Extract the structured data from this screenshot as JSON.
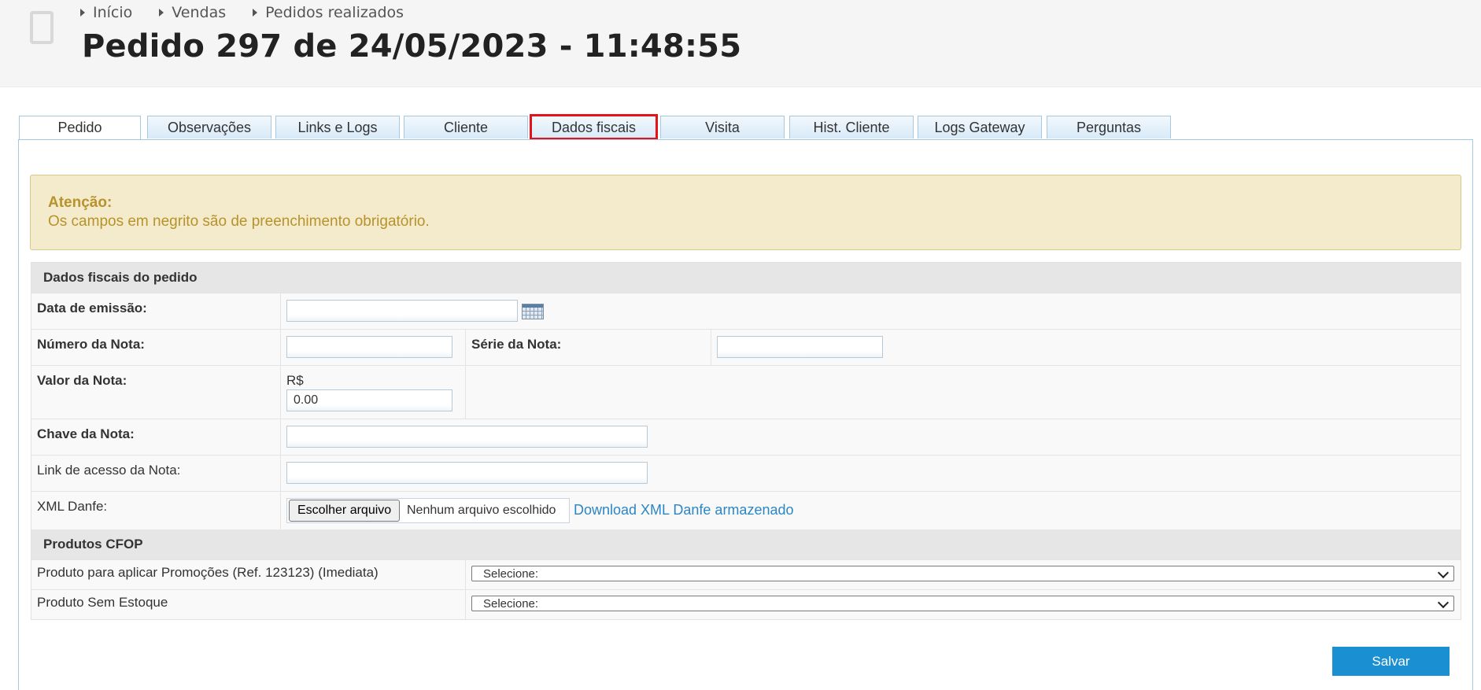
{
  "breadcrumb": [
    "Início",
    "Vendas",
    "Pedidos realizados"
  ],
  "page_title": "Pedido 297 de 24/05/2023 - 11:48:55",
  "tabs": [
    {
      "label": "Pedido"
    },
    {
      "label": "Observações"
    },
    {
      "label": "Links e Logs"
    },
    {
      "label": "Cliente"
    },
    {
      "label": "Dados fiscais"
    },
    {
      "label": "Visita"
    },
    {
      "label": "Hist. Cliente"
    },
    {
      "label": "Logs Gateway"
    },
    {
      "label": "Perguntas"
    }
  ],
  "alert": {
    "title": "Atenção:",
    "message": "Os campos em negrito são de preenchimento obrigatório."
  },
  "fiscal": {
    "section_title": "Dados fiscais do pedido",
    "data_emissao_label": "Data de emissão:",
    "data_emissao_value": "",
    "numero_nota_label": "Número da Nota:",
    "numero_nota_value": "",
    "serie_nota_label": "Série da Nota:",
    "serie_nota_value": "",
    "valor_nota_label": "Valor da Nota:",
    "currency": "R$",
    "valor_nota_value": "0.00",
    "chave_nota_label": "Chave da Nota:",
    "chave_nota_value": "",
    "link_nota_label": "Link de acesso da Nota:",
    "link_nota_value": "",
    "xml_label": "XML Danfe:",
    "file_button": "Escolher arquivo",
    "file_status": "Nenhum arquivo escolhido",
    "download_link": "Download XML Danfe armazenado"
  },
  "cfop": {
    "section_title": "Produtos CFOP",
    "products": [
      {
        "label": "Produto para aplicar Promoções (Ref. 123123) (Imediata)",
        "selected": "Selecione:"
      },
      {
        "label": "Produto Sem Estoque",
        "selected": "Selecione:"
      }
    ]
  },
  "save_label": "Salvar"
}
